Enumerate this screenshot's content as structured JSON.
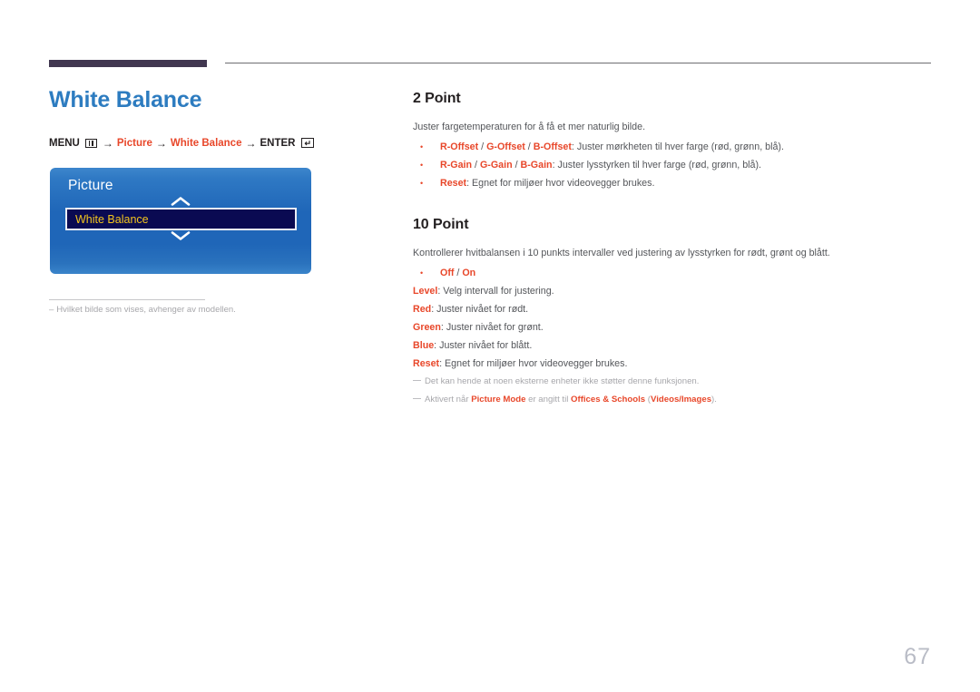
{
  "header": {
    "accent_bar_color": "#413750",
    "rule_color": "#6e6e72"
  },
  "left": {
    "title": "White Balance",
    "menu_path": {
      "menu_label": "MENU",
      "menu_icon": "menu-bars-icon",
      "arrow": "→",
      "step1": "Picture",
      "step2": "White Balance",
      "enter_label": "ENTER",
      "enter_icon": "enter-key-icon"
    },
    "osd": {
      "title": "Picture",
      "chevron_up_icon": "chevron-up-icon",
      "chevron_down_icon": "chevron-down-icon",
      "selected_item": "White Balance",
      "selected_text_color": "#f3c51d",
      "selected_bg_color": "#0a0a52"
    },
    "footnote": "Hvilket bilde som vises, avhenger av modellen."
  },
  "right": {
    "section_2point": {
      "title": "2 Point",
      "intro": "Juster fargetemperaturen for å få et mer naturlig bilde.",
      "bullets": [
        {
          "keys": [
            "R-Offset",
            "G-Offset",
            "B-Offset"
          ],
          "desc": ": Juster mørkheten til hver farge (rød, grønn, blå)."
        },
        {
          "keys": [
            "R-Gain",
            "G-Gain",
            "B-Gain"
          ],
          "desc": ": Juster lysstyrken til hver farge (rød, grønn, blå)."
        },
        {
          "keys": [
            "Reset"
          ],
          "desc": ": Egnet for miljøer hvor videovegger brukes."
        }
      ]
    },
    "section_10point": {
      "title": "10 Point",
      "intro": "Kontrollerer hvitbalansen i 10 punkts intervaller ved justering av lysstyrken for rødt, grønt og blått.",
      "bullets": [
        {
          "keys": [
            "Off",
            "On"
          ],
          "desc": ""
        }
      ],
      "lines": [
        {
          "key": "Level",
          "desc": ": Velg intervall for justering."
        },
        {
          "key": "Red",
          "desc": ": Juster nivået for rødt."
        },
        {
          "key": "Green",
          "desc": ": Juster nivået for grønt."
        },
        {
          "key": "Blue",
          "desc": ": Juster nivået for blått."
        },
        {
          "key": "Reset",
          "desc": ": Egnet for miljøer hvor videovegger brukes."
        }
      ],
      "notes": [
        {
          "pre": "Det kan hende at noen eksterne enheter ikke støtter denne funksjonen.",
          "k1": "",
          "mid": "",
          "k2": "",
          "mid2": "",
          "k3": "",
          "post": ""
        },
        {
          "pre": "Aktivert når ",
          "k1": "Picture Mode",
          "mid": " er angitt til ",
          "k2": "Offices & Schools",
          "mid2": " (",
          "k3": "Videos/Images",
          "post": ")."
        }
      ]
    }
  },
  "page_number": "67"
}
